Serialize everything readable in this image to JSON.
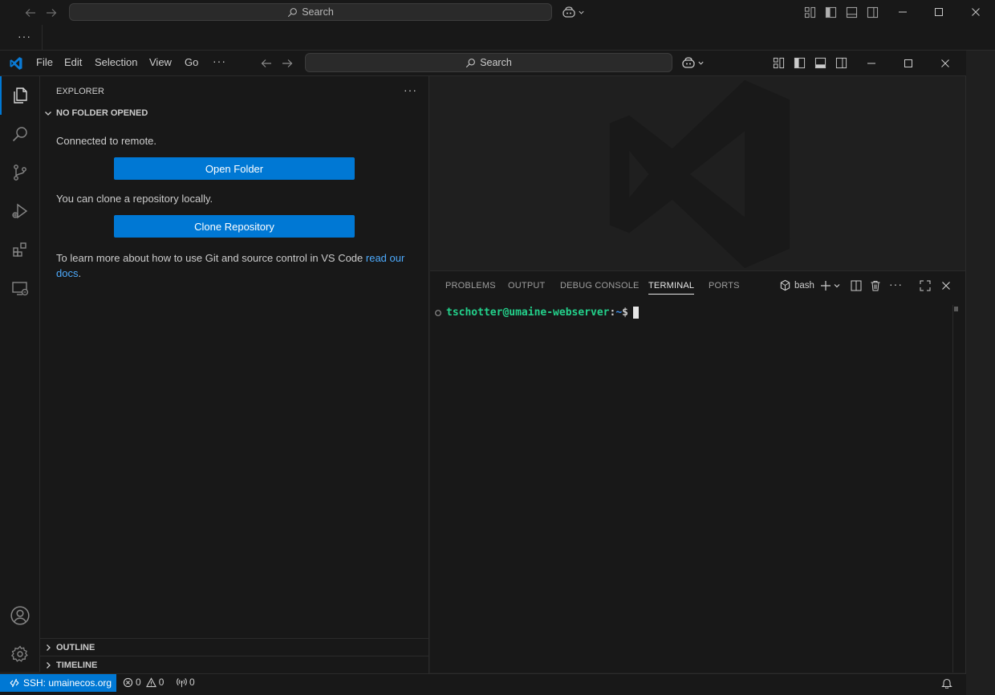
{
  "outer": {
    "search_label": "Search",
    "more_label": "···"
  },
  "titlebar": {
    "menu": [
      "File",
      "Edit",
      "Selection",
      "View",
      "Go"
    ],
    "more_label": "···",
    "search_label": "Search"
  },
  "activity_bar": {
    "items": [
      "files-icon",
      "search-icon",
      "source-control-icon",
      "run-debug-icon",
      "extensions-icon",
      "remote-explorer-icon"
    ],
    "bottom": [
      "account-icon",
      "settings-gear-icon"
    ]
  },
  "sidebar": {
    "title": "EXPLORER",
    "more_label": "···",
    "section_title": "NO FOLDER OPENED",
    "connected_text": "Connected to remote.",
    "open_folder_label": "Open Folder",
    "clone_text": "You can clone a repository locally.",
    "clone_label": "Clone Repository",
    "learn_text": "To learn more about how to use Git and source control in VS Code ",
    "learn_link_1": "read our",
    "learn_link_2": "docs",
    "learn_end": ".",
    "outline_label": "OUTLINE",
    "timeline_label": "TIMELINE"
  },
  "panel": {
    "tabs": [
      "PROBLEMS",
      "OUTPUT",
      "DEBUG CONSOLE",
      "TERMINAL",
      "PORTS"
    ],
    "active_tab": "TERMINAL",
    "terminal_name": "bash",
    "more_label": "···",
    "prompt_user_host": "tschotter@umaine-webserver",
    "prompt_colon": ":",
    "prompt_path": "~",
    "prompt_symbol": "$"
  },
  "statusbar": {
    "remote_label": "SSH: umainecos.org",
    "errors": "0",
    "warnings": "0",
    "ports": "0"
  },
  "colors": {
    "accent": "#0078d4",
    "prompt_green": "#23d18b",
    "prompt_blue": "#3b8eea",
    "link": "#4daafc"
  }
}
